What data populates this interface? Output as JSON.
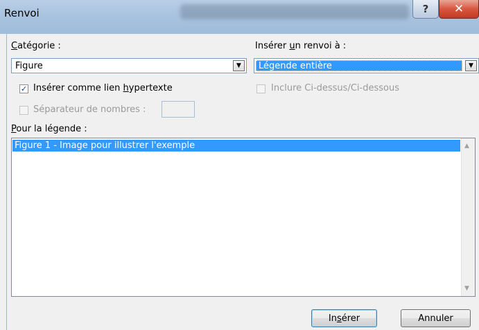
{
  "window": {
    "title": "Renvoi",
    "help_label": "?",
    "close_label": "✕"
  },
  "category": {
    "label_accel": "C",
    "label_rest": "atégorie :",
    "value": "Figure"
  },
  "reference_to": {
    "label_pre": "Insérer ",
    "label_accel": "u",
    "label_post": "n renvoi à :",
    "value": "Légende entière"
  },
  "hyperlink": {
    "label_pre": "Insérer comme lien ",
    "label_accel": "h",
    "label_post": "ypertexte",
    "checked": true
  },
  "include_above_below": {
    "label": "Inclure Ci-dessus/Ci-dessous",
    "checked": false,
    "enabled": false
  },
  "separator": {
    "label": "Séparateur de nombres :",
    "value": "",
    "enabled": false
  },
  "caption_list": {
    "label_accel": "P",
    "label_rest": "our la légende :",
    "items": [
      "Figure 1 - Image pour illustrer l'exemple"
    ],
    "selected_index": 0
  },
  "buttons": {
    "insert_pre": "In",
    "insert_accel": "s",
    "insert_post": "érer",
    "cancel": "Annuler"
  },
  "colors": {
    "selection": "#3399ff",
    "titlebar": "#a9c3df",
    "close": "#c9452d"
  },
  "icons": {
    "dropdown": "chevron-down-icon",
    "checkmark": "checkmark-icon",
    "scroll_up": "scroll-up-icon",
    "scroll_down": "scroll-down-icon"
  }
}
